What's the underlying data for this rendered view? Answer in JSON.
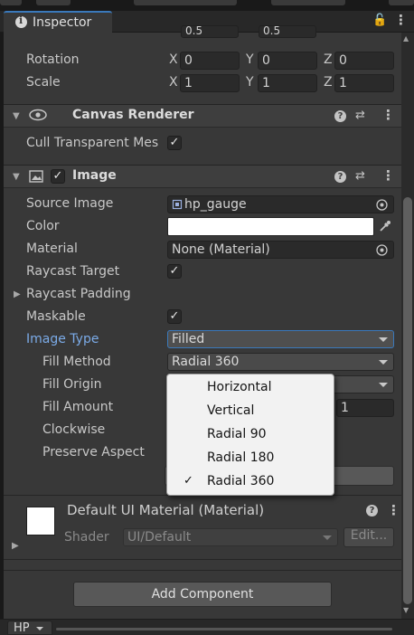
{
  "tab": {
    "title": "Inspector"
  },
  "transform": {
    "rotation_label": "Rotation",
    "scale_label": "Scale",
    "axis_x": "X",
    "axis_y": "Y",
    "axis_z": "Z",
    "partial_top": "0.5",
    "partial_top2": "0.5",
    "rotation": {
      "x": "0",
      "y": "0",
      "z": "0"
    },
    "scale": {
      "x": "1",
      "y": "1",
      "z": "1"
    }
  },
  "canvas_renderer": {
    "title": "Canvas Renderer",
    "cull_label": "Cull Transparent Mes"
  },
  "image": {
    "title": "Image",
    "source_image_label": "Source Image",
    "source_image_value": "hp_gauge",
    "color_label": "Color",
    "material_label": "Material",
    "material_value": "None (Material)",
    "raycast_target_label": "Raycast Target",
    "raycast_padding_label": "Raycast Padding",
    "maskable_label": "Maskable",
    "image_type_label": "Image Type",
    "image_type_value": "Filled",
    "fill_method_label": "Fill Method",
    "fill_method_value": "Radial 360",
    "fill_origin_label": "Fill Origin",
    "fill_amount_label": "Fill Amount",
    "fill_amount_value": "1",
    "clockwise_label": "Clockwise",
    "preserve_aspect_label": "Preserve Aspect"
  },
  "fill_method_menu": {
    "options": [
      "Horizontal",
      "Vertical",
      "Radial 90",
      "Radial 180",
      "Radial 360"
    ],
    "selected": "Radial 360"
  },
  "material_section": {
    "title": "Default UI Material (Material)",
    "shader_label": "Shader",
    "shader_value": "UI/Default",
    "edit_label": "Edit..."
  },
  "add_component_label": "Add Component",
  "bottom_tab": {
    "label": "HP"
  },
  "colors": {
    "accent": "#3a79bb",
    "panel": "#383838",
    "label_blue": "#7babe8"
  }
}
